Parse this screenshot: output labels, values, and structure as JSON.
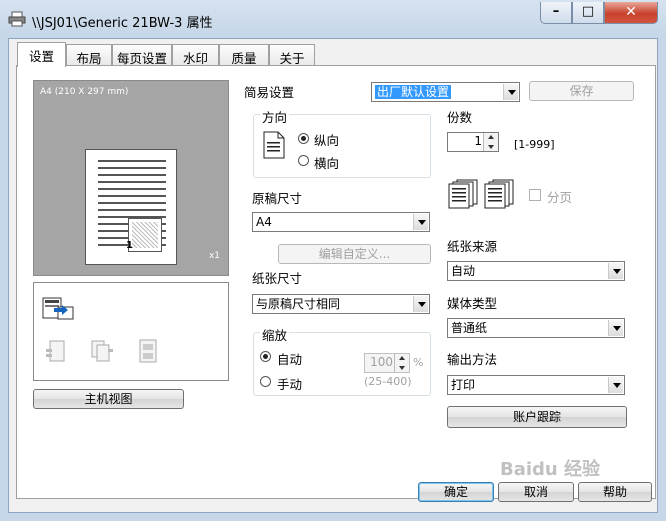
{
  "window": {
    "title": "\\\\JSJ01\\Generic 21BW-3 属性",
    "minimize": "–",
    "maximize": "□",
    "close": "✕"
  },
  "tabs": [
    {
      "label": "设置",
      "active": true
    },
    {
      "label": "布局",
      "active": false
    },
    {
      "label": "每页设置",
      "active": false
    },
    {
      "label": "水印",
      "active": false
    },
    {
      "label": "质量",
      "active": false
    },
    {
      "label": "关于",
      "active": false
    }
  ],
  "preview": {
    "caption": "A4  (210 X 297 mm)",
    "copies_badge": "x1",
    "overlay_number": "1",
    "host_view_button": "主机视图"
  },
  "easy_settings": {
    "label": "简易设置",
    "value": "出厂默认设置",
    "save_button": "保存"
  },
  "orientation": {
    "title": "方向",
    "portrait": "纵向",
    "landscape": "横向",
    "selected": "portrait"
  },
  "original_size": {
    "label": "原稿尺寸",
    "value": "A4",
    "edit_custom_button": "编辑自定义..."
  },
  "paper_size": {
    "label": "纸张尺寸",
    "value": "与原稿尺寸相同"
  },
  "zoom": {
    "title": "缩放",
    "auto": "自动",
    "manual": "手动",
    "selected": "auto",
    "value": "100",
    "unit": "%",
    "range": "(25-400)"
  },
  "copies": {
    "label": "份数",
    "value": "1",
    "range": "[1-999]",
    "collate_label": "分页",
    "collate_checked": false
  },
  "paper_source": {
    "label": "纸张来源",
    "value": "自动"
  },
  "media_type": {
    "label": "媒体类型",
    "value": "普通纸"
  },
  "output_method": {
    "label": "输出方法",
    "value": "打印",
    "account_track_button": "账户跟踪"
  },
  "footer": {
    "ok": "确定",
    "cancel": "取消",
    "help": "帮助"
  },
  "watermark": "Baidu 经验",
  "colors": {
    "accent_blue": "#3399ff",
    "title_bar": "#c5d6e8",
    "close_red": "#c8412c"
  }
}
